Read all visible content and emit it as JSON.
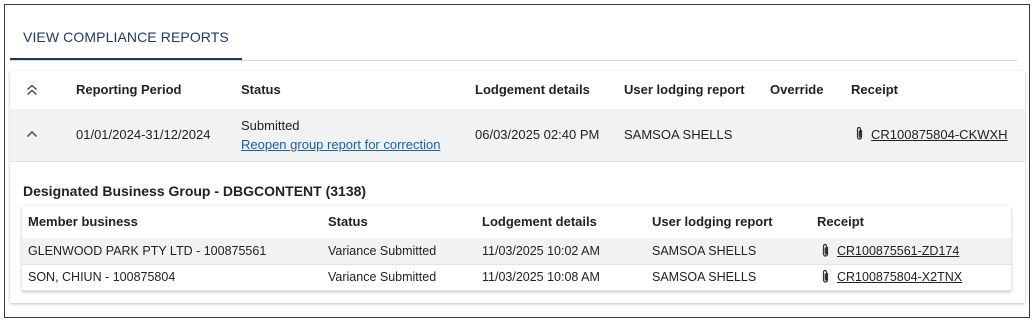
{
  "tab": {
    "label": "VIEW COMPLIANCE REPORTS"
  },
  "colors": {
    "accent": "#1e3a5c",
    "link": "#1d5fa6",
    "row_highlight": "#f1f2f4"
  },
  "main_table": {
    "headers": {
      "reporting_period": "Reporting Period",
      "status": "Status",
      "lodgement_details": "Lodgement details",
      "user_lodging_report": "User lodging report",
      "override": "Override",
      "receipt": "Receipt"
    },
    "header_icon": "collapse-all-icon",
    "row": {
      "toggle_icon": "chevron-up-icon",
      "reporting_period": "01/01/2024-31/12/2024",
      "status": "Submitted",
      "status_link": "Reopen group report for correction",
      "lodgement_details": "06/03/2025 02:40 PM",
      "user_lodging_report": "SAMSOA SHELLS",
      "override": "",
      "receipt_icon": "paperclip-icon",
      "receipt": "CR100875804-CKWXH"
    }
  },
  "group": {
    "title": "Designated Business Group - DBGCONTENT (3138)",
    "headers": {
      "member_business": "Member business",
      "status": "Status",
      "lodgement_details": "Lodgement details",
      "user_lodging_report": "User lodging report",
      "receipt": "Receipt"
    },
    "rows": [
      {
        "member_business": "GLENWOOD PARK PTY LTD - 100875561",
        "status": "Variance Submitted",
        "lodgement_details": "11/03/2025 10:02 AM",
        "user_lodging_report": "SAMSOA SHELLS",
        "receipt": "CR100875561-ZD174"
      },
      {
        "member_business": "SON, CHIUN - 100875804",
        "status": "Variance Submitted",
        "lodgement_details": "11/03/2025 10:08 AM",
        "user_lodging_report": "SAMSOA SHELLS",
        "receipt": "CR100875804-X2TNX"
      }
    ]
  }
}
